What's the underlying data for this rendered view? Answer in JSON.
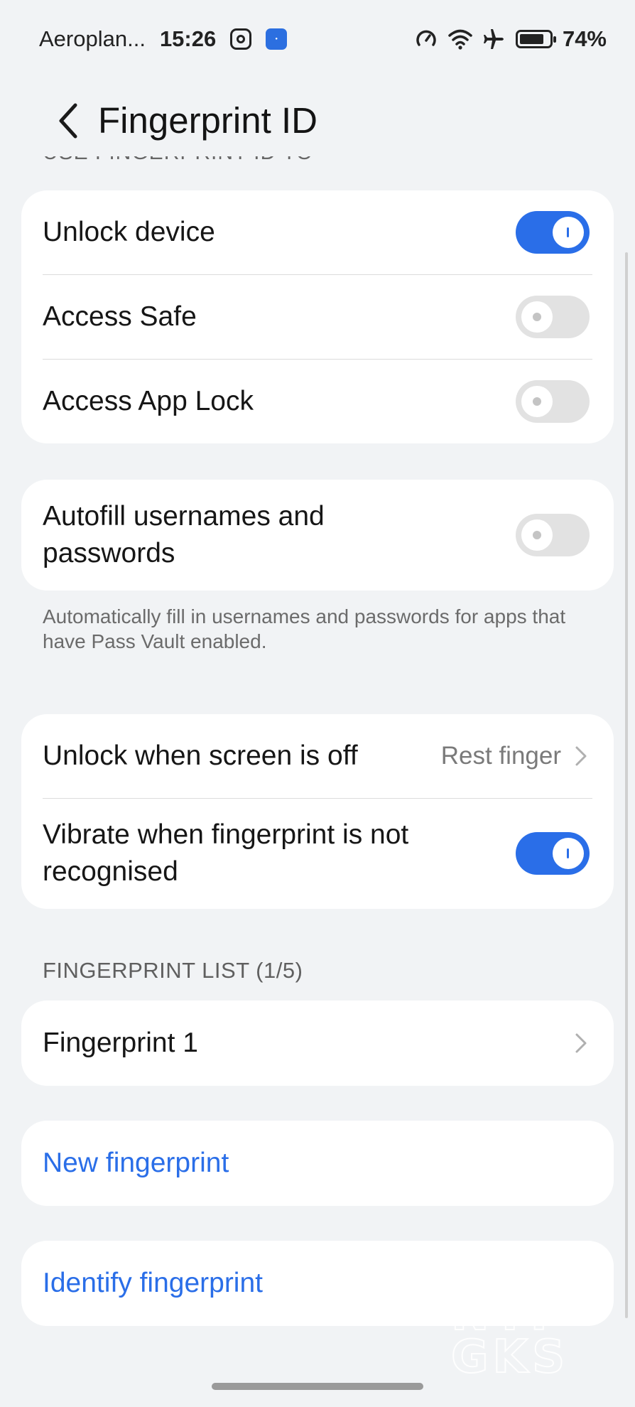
{
  "status_bar": {
    "carrier": "Aeroplan...",
    "time": "15:26",
    "battery": "74%"
  },
  "header": {
    "title": "Fingerprint ID",
    "cut_section_label": "USE FINGERPRINT ID TO"
  },
  "use_for": {
    "items": [
      {
        "label": "Unlock device",
        "enabled": true
      },
      {
        "label": "Access Safe",
        "enabled": false
      },
      {
        "label": "Access App Lock",
        "enabled": false
      }
    ]
  },
  "autofill": {
    "label": "Autofill usernames and passwords",
    "enabled": false,
    "description": "Automatically fill in usernames and passwords for apps that have Pass Vault enabled."
  },
  "screen_off": {
    "label": "Unlock when screen is off",
    "value": "Rest finger"
  },
  "vibrate": {
    "label": "Vibrate when fingerprint is not recognised",
    "enabled": true
  },
  "fingerprint_list": {
    "header": "FINGERPRINT LIST (1/5)",
    "items": [
      {
        "label": "Fingerprint 1"
      }
    ]
  },
  "actions": {
    "new_fingerprint": "New fingerprint",
    "identify_fingerprint": "Identify fingerprint"
  },
  "colors": {
    "accent": "#2a6ee8",
    "background": "#f1f3f5",
    "card": "#ffffff"
  },
  "watermark": "NYP GKS"
}
